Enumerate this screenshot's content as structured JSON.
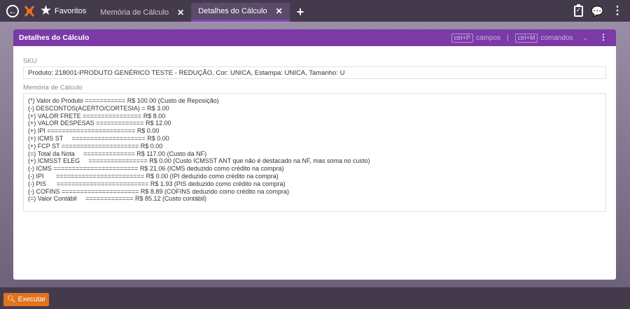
{
  "topbar": {
    "favorites_label": "Favoritos",
    "tabs": [
      {
        "label": "Memória de Cálculo",
        "close": "✕"
      },
      {
        "label": "Detalhes do Cálculo",
        "close": "✕"
      }
    ],
    "add_tab": "+",
    "icons": [
      "back-arrow-icon",
      "app-logo-icon",
      "star-icon",
      "clipboard-check-icon",
      "chat-icon",
      "kebab-menu-icon"
    ]
  },
  "panel": {
    "title": "Detalhes do Cálculo",
    "hint_fields_key": "ctrl+P",
    "hint_fields_label": "campos",
    "hint_separator": "|",
    "hint_commands_key": "ctrl+M",
    "hint_commands_label": "comandos"
  },
  "form": {
    "sku_label": "SKU",
    "sku_value": "Produto: 218001-PRODUTO GENÉRICO TESTE - REDUÇÃO, Cor: UNICA, Estampa: UNICA, Tamanho: U",
    "memo_label": "Memória de Cálculo",
    "memo_lines": [
      "(*) Valor do Produto =========== R$ 100.00 (Custo de Reposição)",
      "(-) DESCONTOS(ACERTO/CORTESIA) = R$ 3.00",
      "(+) VALOR FRETE ================ R$ 8.00",
      "(+) VALOR DESPESAS ============= R$ 12.00",
      "(+) IPI ======================== R$ 0.00",
      "(+) ICMS ST     ==================== R$ 0.00",
      "(+) FCP ST ===================== R$ 0.00",
      "(=) Total da Nota     ============== R$ 117.00 (Custo da NF)",
      "(+) ICMSST ELEG     ================ R$ 0.00 (Custo ICMSST ANT que não é destacado na NF, mas soma no custo)",
      "(-) ICMS ======================= R$ 21.06 (ICMS deduzido como crédito na compra)",
      "(-) IPI       ======================== R$ 0.00 (IPI deduzido como crédito na compra)",
      "(-) PIS      ========================= R$ 1.93 (PIS deduzido como crédito na compra)",
      "(-) COFINS ===================== R$ 8.89 (COFINS deduzido como crédito na compra)",
      "(=) Valor Contábil     ============= R$ 85.12 (Custo contábil)"
    ]
  },
  "bottombar": {
    "execute_label": "Executar"
  },
  "colors": {
    "topbar": "#433a4c",
    "panel_header": "#7b3aa8",
    "execute_button": "#e0731f"
  }
}
